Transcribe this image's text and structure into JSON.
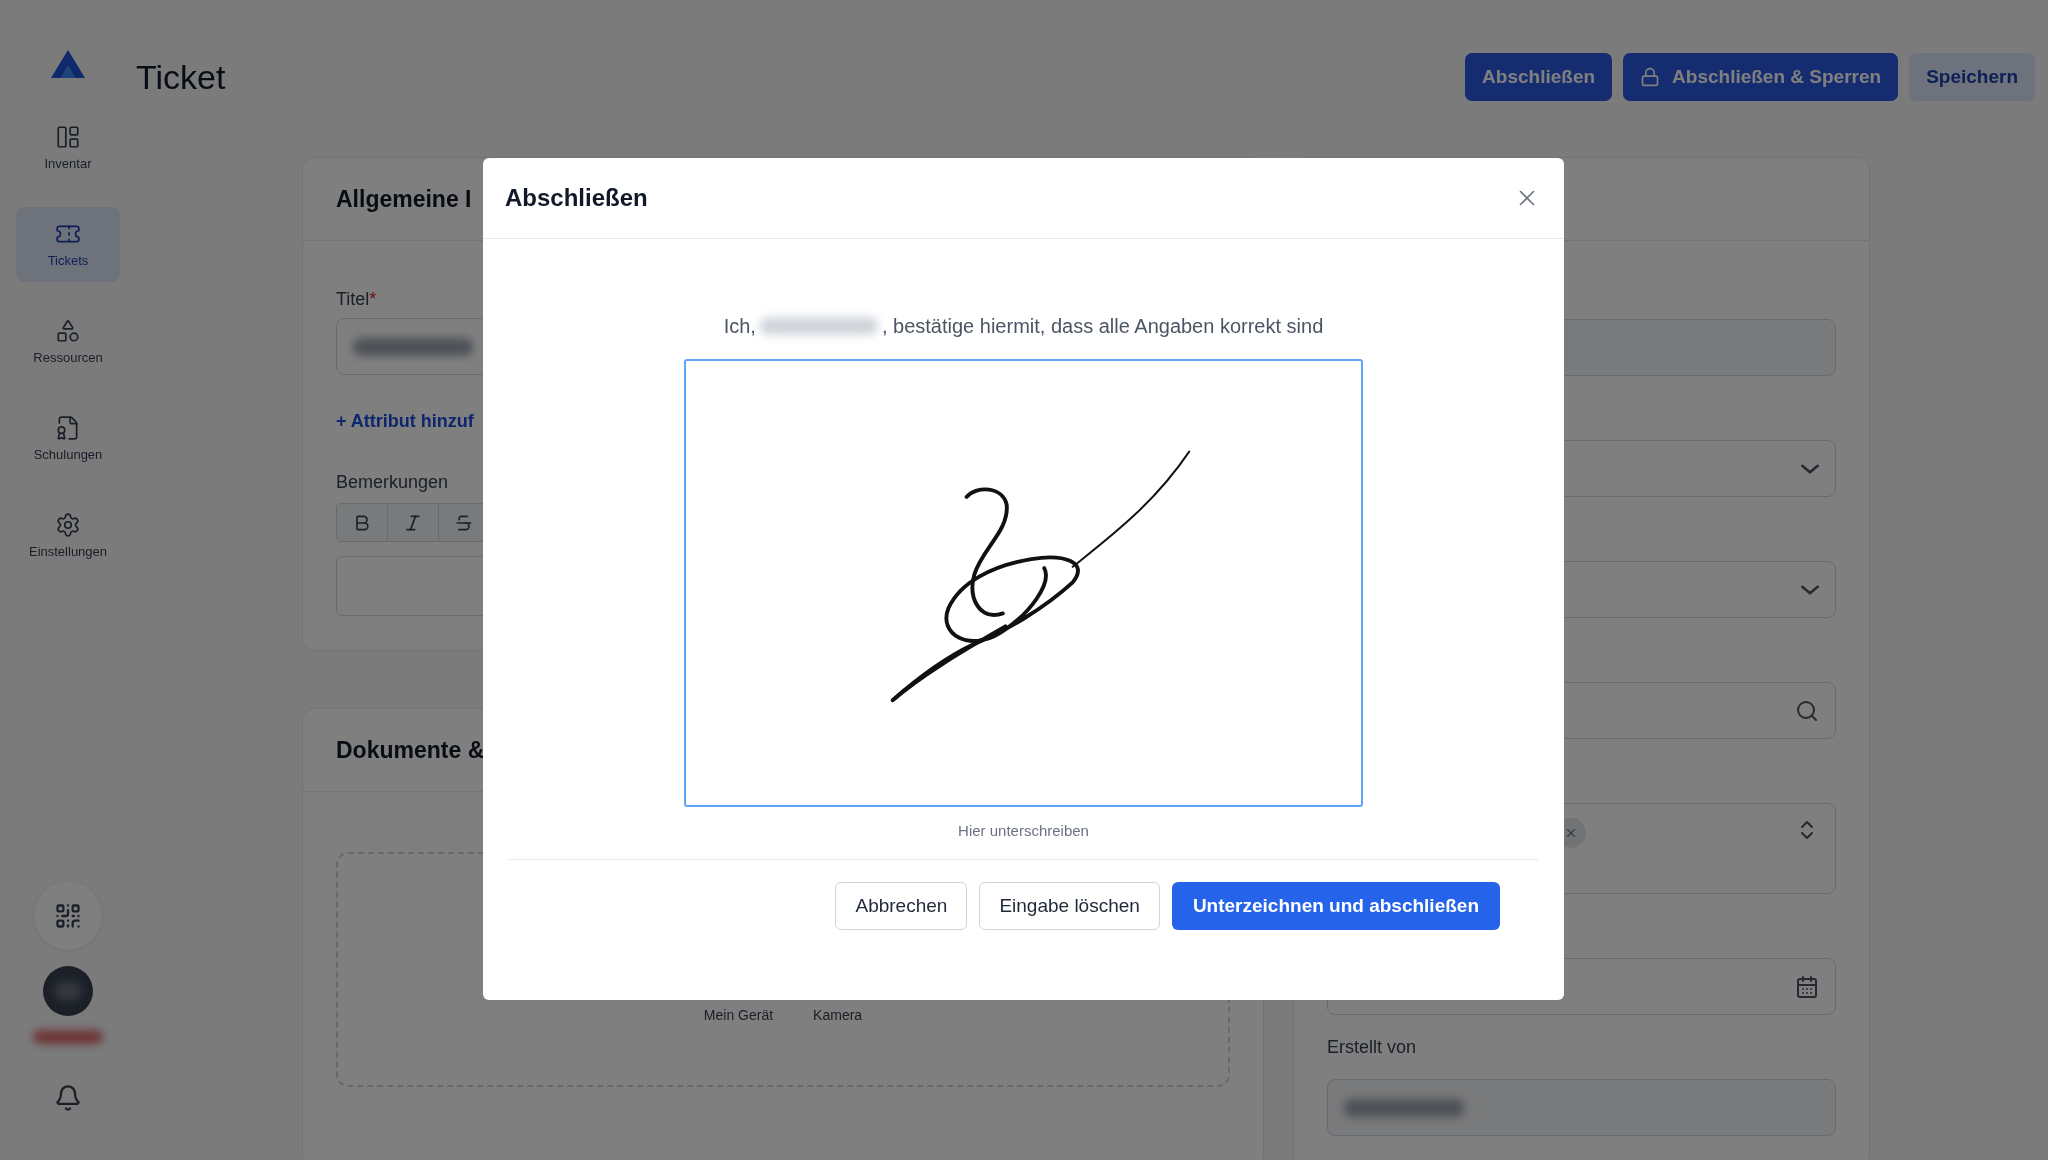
{
  "sidebar": {
    "items": [
      {
        "label": "Inventar",
        "selected": false
      },
      {
        "label": "Tickets",
        "selected": true
      },
      {
        "label": "Ressourcen",
        "selected": false
      },
      {
        "label": "Schulungen",
        "selected": false
      },
      {
        "label": "Einstellungen",
        "selected": false
      }
    ]
  },
  "page_title": "Ticket",
  "header_buttons": [
    {
      "label": "Abschließen",
      "kind": "primary"
    },
    {
      "label": "Abschließen & Sperren",
      "kind": "lock"
    },
    {
      "label": "Speichern",
      "kind": "secondary"
    }
  ],
  "general_card": {
    "title": "Allgemeine I",
    "title_label": "Titel",
    "required_mark": "*",
    "add_attribute": "+ Attribut hinzuf",
    "remarks_label": "Bemerkungen"
  },
  "documents_card": {
    "title": "Dokumente &",
    "upload_options": [
      "Mein Gerät",
      "Kamera"
    ]
  },
  "details_card": {
    "fields": [
      {
        "kind": "input"
      },
      {
        "kind": "select"
      },
      {
        "kind": "select"
      },
      {
        "kind": "search"
      },
      {
        "kind": "multiselect"
      },
      {
        "kind": "date"
      },
      {
        "kind": "input",
        "label": "Erstellt von"
      }
    ]
  },
  "dialog": {
    "title": "Abschließen",
    "statement_prefix": "Ich,",
    "statement_suffix": ", bestätige hiermit, dass alle Angaben korrekt sind",
    "signature_hint": "Hier unterschreiben",
    "buttons": [
      {
        "label": "Abbrechen",
        "kind": "outline"
      },
      {
        "label": "Eingabe löschen",
        "kind": "outline"
      },
      {
        "label": "Unterzeichnen und abschließen",
        "kind": "primary"
      }
    ]
  }
}
